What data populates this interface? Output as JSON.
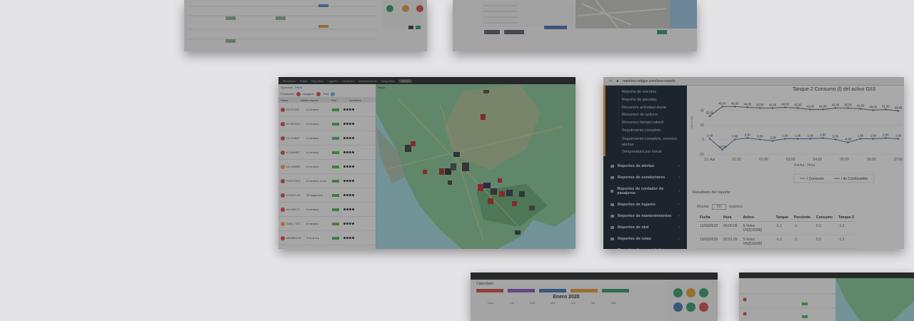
{
  "fleet_card": {
    "nav": [
      "Monitoreo",
      "Rutas",
      "Reportes",
      "Lugares",
      "Unidades",
      "Mantenimiento",
      "Seguridad",
      "Alertas"
    ],
    "toolbar": [
      "Opciones",
      "Filtrar"
    ],
    "legend": [
      "Encendido",
      "Apagado",
      "Total"
    ],
    "columns": [
      "Placa",
      "Último reporte",
      "Edo",
      "Acciones"
    ],
    "rows": [
      {
        "plate": "06-FCV0F",
        "time": "6 minutos",
        "color": "#d9534f"
      },
      {
        "plate": "42-BD9C8",
        "time": "6 minutos",
        "color": "#d9534f"
      },
      {
        "plate": "74-CDB8T",
        "time": "2 minutos",
        "color": "#d9534f"
      },
      {
        "plate": "42-BH8BT",
        "time": "6 minutos",
        "color": "#d9534f"
      },
      {
        "plate": "04-VM0BS",
        "time": "6 minutos",
        "color": "#f0ad4e"
      },
      {
        "plate": "7HCF7A0T",
        "time": "6 minutos, 8 hrs",
        "color": "#d9534f"
      },
      {
        "plate": "LCNCE-31",
        "time": "35 segundos",
        "color": "#d9534f"
      },
      {
        "plate": "45-DMC77",
        "time": "6 minutos",
        "color": "#d9534f"
      },
      {
        "plate": "4VM-T7GT",
        "time": "6 minutos",
        "color": "#f0ad4e"
      },
      {
        "plate": "4BUBDC-N",
        "time": "1 hr, 8 hrs",
        "color": "#d9534f"
      }
    ],
    "footer": [
      "Mostrar todos",
      "Ocultar todos"
    ],
    "map_label": "Mapa"
  },
  "report_card": {
    "url": "reportes.redgps.com/new-reports",
    "chart_title": "Tanque 2 Consumo (l) del activo GIIS",
    "sidebar_subitems": [
      "Reporte de eventos",
      "Reporte de paradas",
      "Resumen actividad diaria",
      "Resumen de activos",
      "Resumen tiempo ralentí",
      "Seguimiento completo",
      "Seguimiento completo, eventos, alertas",
      "Temperatura por horas"
    ],
    "sidebar_categories": [
      "Reportes de alertas",
      "Reportes de conductores",
      "Reportes de contador de pasajeros",
      "Reportes de lugares",
      "Reportes de mantenimientos",
      "Reportes de obd",
      "Reportes de rutas",
      "Reportes de seguridad"
    ],
    "results_title": "Resultado del reporte",
    "show_label": "Mostrar",
    "show_value": "50",
    "records_label": "registros",
    "table_headers": [
      "Fecha",
      "Hora",
      "Activo",
      "Tanque",
      "Porciento",
      "Consumo",
      "Tanque 2"
    ],
    "table_rows": [
      [
        "13/03/2018",
        "00:00:06",
        "5-Volvo VN2[19395]",
        "-1.1",
        "-1",
        "0.1",
        "-1.1"
      ],
      [
        "13/03/2018",
        "00:51:26",
        "5-Volvo VN2[19395]",
        "-1.1",
        "-1",
        "0.1",
        "-1.1"
      ]
    ],
    "x_label": "Fecha - Hora",
    "legend": [
      "l Consumo",
      "l de Combustible"
    ]
  },
  "chart_data": {
    "type": "line",
    "title": "Tanque 2 Consumo (l) del activo GIIS",
    "xlabel": "Fecha - Hora",
    "ylabel": "Litros (lts)",
    "x": [
      "13. Apr",
      "01:00",
      "02:00",
      "03:00",
      "04:00",
      "05:00",
      "06:00",
      "07:00"
    ],
    "ylim": [
      -20,
      60
    ],
    "yticks": [
      -20,
      0,
      20,
      40
    ],
    "series": [
      {
        "name": "l de Combustible",
        "values": [
          32.0,
          45.0,
          45.0,
          44.0,
          43.0,
          43.0,
          44.0,
          43.0,
          41.0,
          41.0,
          43.0,
          43.0,
          42.0,
          40.0,
          41.0,
          39.0
        ],
        "color": "#6b7b8e"
      },
      {
        "name": "l Consumo",
        "values": [
          1.0,
          -14.0,
          0.0,
          2.0,
          0.0,
          -2.0,
          1.0,
          1.0,
          1.0,
          2.0,
          0.0,
          -4.0,
          1.0,
          1.0,
          2.0,
          1.0
        ],
        "color": "#5f86b8"
      }
    ]
  },
  "calendar_card": {
    "heading": "Calendario",
    "month": "Enero 2020",
    "weekdays": [
      "Dom",
      "Lun",
      "Mar",
      "Mie",
      "Jue",
      "Vie",
      "Sab"
    ],
    "side_title": "Funciones"
  },
  "colors": {
    "fleet_red": "#d9534f",
    "fleet_orange": "#f0ad4e",
    "sidebar": "#1d2a36",
    "map_land": "#8cc99a",
    "map_water": "#a6dbe4"
  }
}
